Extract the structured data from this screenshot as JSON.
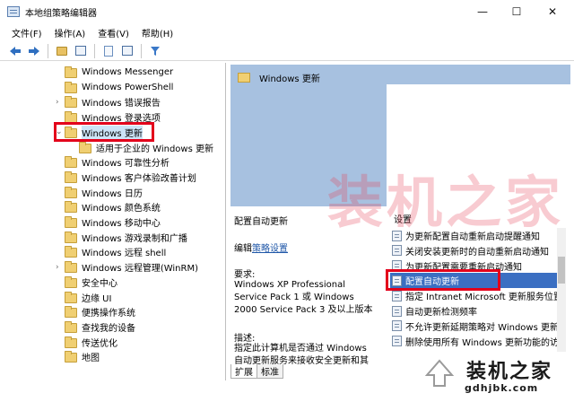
{
  "window": {
    "title": "本地组策略编辑器",
    "controls": {
      "minimize": "—",
      "maximize": "☐",
      "close": "✕"
    }
  },
  "menu": [
    "文件(F)",
    "操作(A)",
    "查看(V)",
    "帮助(H)"
  ],
  "toolbar": {
    "icons": [
      "back-arrow-icon",
      "forward-arrow-icon",
      "folder-up-icon",
      "show-hide-tree-icon",
      "export-icon",
      "properties-icon",
      "filter-icon"
    ]
  },
  "tree": {
    "items": [
      {
        "label": "Windows Messenger",
        "arrow": ""
      },
      {
        "label": "Windows PowerShell",
        "arrow": ""
      },
      {
        "label": "Windows 错误报告",
        "arrow": "›"
      },
      {
        "label": "Windows 登录选项",
        "arrow": ""
      },
      {
        "label": "Windows 更新",
        "arrow": "⌄",
        "selected": true
      },
      {
        "label": "适用于企业的 Windows 更新",
        "arrow": "",
        "child": true
      },
      {
        "label": "Windows 可靠性分析",
        "arrow": ""
      },
      {
        "label": "Windows 客户体验改善计划",
        "arrow": ""
      },
      {
        "label": "Windows 日历",
        "arrow": ""
      },
      {
        "label": "Windows 颜色系统",
        "arrow": ""
      },
      {
        "label": "Windows 移动中心",
        "arrow": ""
      },
      {
        "label": "Windows 游戏录制和广播",
        "arrow": ""
      },
      {
        "label": "Windows 远程 shell",
        "arrow": ""
      },
      {
        "label": "Windows 远程管理(WinRM)",
        "arrow": "›"
      },
      {
        "label": "安全中心",
        "arrow": ""
      },
      {
        "label": "边缘 UI",
        "arrow": ""
      },
      {
        "label": "便携操作系统",
        "arrow": ""
      },
      {
        "label": "查找我的设备",
        "arrow": ""
      },
      {
        "label": "传送优化",
        "arrow": ""
      },
      {
        "label": "地图",
        "arrow": ""
      }
    ]
  },
  "right": {
    "header_title": "Windows 更新",
    "description": {
      "title": "配置自动更新",
      "edit_prefix": "编辑",
      "edit_link": "策略设置",
      "requirements_label": "要求:",
      "requirements_text": "Windows XP Professional Service Pack 1 或 Windows 2000 Service Pack 3 及以上版本",
      "description_label": "描述:",
      "description_text": "指定此计算机是否通过 Windows 自动更新服务来接收安全更新和其"
    },
    "settings_header": "设置",
    "settings": [
      {
        "label": "为更新配置自动重新启动提醒通知"
      },
      {
        "label": "关闭安装更新时的自动重新启动通知"
      },
      {
        "label": "为更新配置需要重新启动通知"
      },
      {
        "label": "配置自动更新",
        "selected": true
      },
      {
        "label": "指定 Intranet Microsoft 更新服务位置"
      },
      {
        "label": "自动更新检测频率"
      },
      {
        "label": "不允许更新延期策略对 Windows 更新"
      },
      {
        "label": "删除使用所有 Windows 更新功能的访"
      }
    ],
    "tabs": [
      "扩展",
      "标准"
    ]
  },
  "watermark": {
    "big_text": "装机之家",
    "brand": "装机之家",
    "site": "gdhjbk.com"
  },
  "colors": {
    "highlight": "#e3001b",
    "selection": "#3b6fc2",
    "header_band": "#a7c1e0"
  }
}
